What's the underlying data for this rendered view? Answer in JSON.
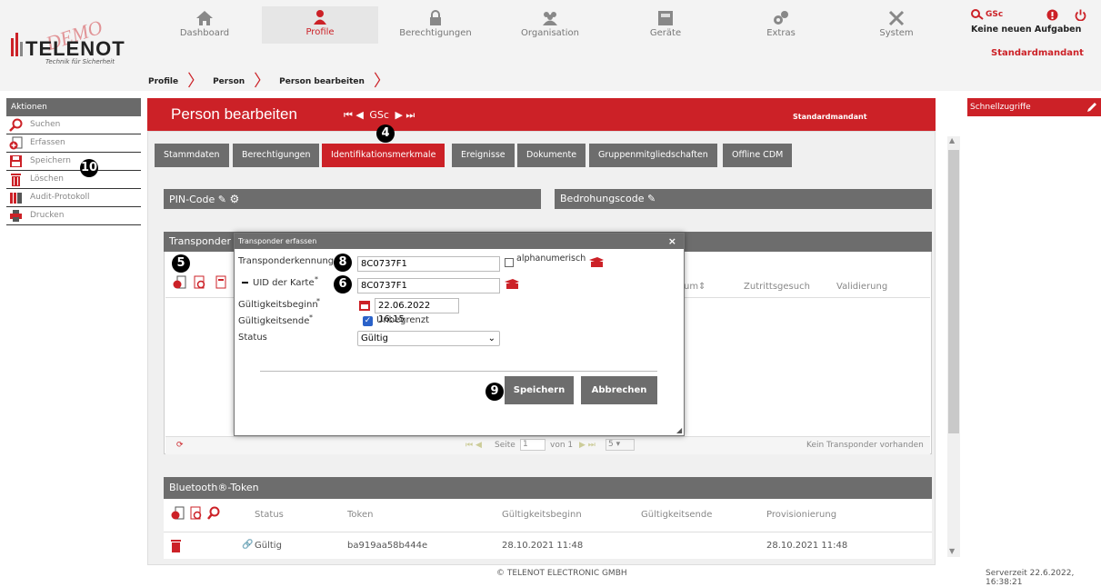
{
  "logo": {
    "brand": "TELENOT",
    "tagline": "Technik für Sicherheit",
    "watermark": "DEMO"
  },
  "nav": [
    {
      "label": "Dashboard",
      "icon": "home-icon"
    },
    {
      "label": "Profile",
      "icon": "person-icon"
    },
    {
      "label": "Berechtigungen",
      "icon": "lock-icon"
    },
    {
      "label": "Organisation",
      "icon": "group-icon"
    },
    {
      "label": "Geräte",
      "icon": "device-icon"
    },
    {
      "label": "Extras",
      "icon": "gears-icon"
    },
    {
      "label": "System",
      "icon": "tools-icon"
    }
  ],
  "user": {
    "name": "GSc",
    "tasks": "Keine neuen Aufgaben",
    "mandant": "Standardmandant"
  },
  "breadcrumb": [
    "Profile",
    "Person",
    "Person bearbeiten"
  ],
  "sidebar": {
    "title": "Aktionen",
    "items": [
      {
        "label": "Suchen",
        "icon": "search-icon"
      },
      {
        "label": "Erfassen",
        "icon": "add-icon"
      },
      {
        "label": "Speichern",
        "icon": "save-icon"
      },
      {
        "label": "Löschen",
        "icon": "trash-icon"
      },
      {
        "label": "Audit-Protokoll",
        "icon": "audit-icon"
      },
      {
        "label": "Drucken",
        "icon": "print-icon"
      }
    ]
  },
  "main": {
    "title": "Person bearbeiten",
    "record": "GSc",
    "mandant": "Standardmandant"
  },
  "quick": {
    "title": "Schnellzugriffe"
  },
  "tabs": [
    "Stammdaten",
    "Berechtigungen",
    "Identifikationsmerkmale",
    "Ereignisse",
    "Dokumente",
    "Gruppenmitgliedschaften",
    "Offline CDM"
  ],
  "sections": {
    "pin": "PIN-Code",
    "threat": "Bedrohungscode",
    "transponder": "Transponder",
    "bluetooth": "Bluetooth®-Token"
  },
  "transponder_cols": [
    "um",
    "Zutrittsgesuch",
    "Validierung"
  ],
  "transponder_footer": {
    "page_label": "Seite",
    "page": "1",
    "of": "von 1",
    "per_page": "5",
    "empty": "Kein Transponder vorhanden"
  },
  "bluetooth_cols": [
    "Status",
    "Token",
    "Gültigkeitsbeginn",
    "Gültigkeitsende",
    "Provisionierung"
  ],
  "bluetooth_rows": [
    {
      "status": "Gültig",
      "token": "ba919aa58b444e",
      "start": "28.10.2021 11:48",
      "end": "",
      "prov": "28.10.2021 11:48"
    }
  ],
  "dialog": {
    "title": "Transponder erfassen",
    "close": "×",
    "transponder_label": "Transponderkennung",
    "transponder_value": "8C0737F1",
    "alphanumeric_label": "alphanumerisch",
    "uid_label": "UID der Karte",
    "uid_value": "8C0737F1",
    "start_label": "Gültigkeitsbeginn",
    "start_value": "22.06.2022 16:15",
    "end_label": "Gültigkeitsende",
    "unlimited_label": "Unbegrenzt",
    "status_label": "Status",
    "status_value": "Gültig",
    "required_mark": "*",
    "save": "Speichern",
    "cancel": "Abbrechen"
  },
  "markers": {
    "m4": "4",
    "m5": "5",
    "m6": "6",
    "m8": "8",
    "m9": "9",
    "m10": "10"
  },
  "footer": {
    "copyright": "© TELENOT ELECTRONIC GMBH",
    "server_time": "Serverzeit 22.6.2022, 16:38:21"
  },
  "colors": {
    "accent": "#cc2127",
    "bar": "#6d6d6d",
    "checkbox": "#2a62c9"
  }
}
